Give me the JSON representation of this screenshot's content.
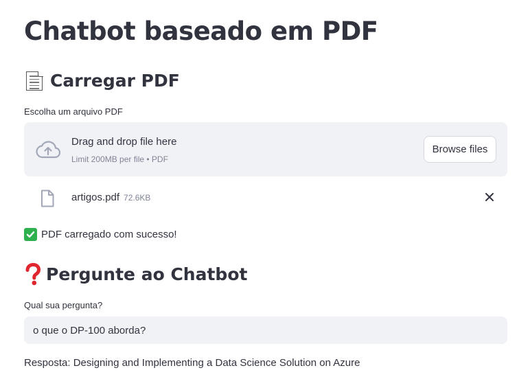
{
  "page": {
    "title": "Chatbot baseado em PDF"
  },
  "upload_section": {
    "heading": "Carregar PDF",
    "heading_icon": "page-facing-up-emoji",
    "label": "Escolha um arquivo PDF",
    "dropzone": {
      "main_text": "Drag and drop file here",
      "limit_text": "Limit 200MB per file • PDF",
      "browse_label": "Browse files",
      "icon": "cloud-upload-icon"
    },
    "uploaded_file": {
      "name": "artigos.pdf",
      "size": "72.6KB",
      "icon": "file-icon",
      "remove_icon": "close-icon"
    },
    "success_message": "PDF carregado com sucesso!",
    "success_icon": "check-mark-emoji"
  },
  "question_section": {
    "heading": "Pergunte ao Chatbot",
    "heading_icon": "red-question-mark-emoji",
    "label": "Qual sua pergunta?",
    "input_value": "o que o DP-100 aborda?",
    "answer": "Resposta: Designing and Implementing a Data Science Solution on Azure"
  },
  "colors": {
    "text": "#31333f",
    "muted": "#808495",
    "field_bg": "#f0f2f6",
    "success_green": "#2eb04f",
    "question_red": "#e0262f"
  }
}
